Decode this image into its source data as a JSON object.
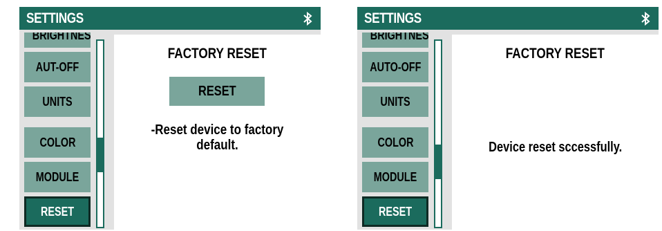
{
  "colors": {
    "accent": "#1b6b5d",
    "menu_item": "#7aa59b",
    "background": "#e2e2e2",
    "panel": "#ffffff"
  },
  "screens": [
    {
      "title": "SETTINGS",
      "status_icon": "bluetooth-icon",
      "menu": [
        {
          "label": "BRIGHTNESS",
          "selected": false
        },
        {
          "label": "AUT-OFF",
          "selected": false
        },
        {
          "label": "UNITS",
          "selected": false
        },
        {
          "label": "COLOR",
          "selected": false
        },
        {
          "label": "MODULE",
          "selected": false
        },
        {
          "label": "RESET",
          "selected": true
        }
      ],
      "panel": {
        "title": "FACTORY RESET",
        "button_label": "RESET",
        "description": "-Reset device to factory default."
      }
    },
    {
      "title": "SETTINGS",
      "status_icon": "bluetooth-icon",
      "menu": [
        {
          "label": "BRIGHTNESS",
          "selected": false
        },
        {
          "label": "AUTO-OFF",
          "selected": false
        },
        {
          "label": "UNITS",
          "selected": false
        },
        {
          "label": "COLOR",
          "selected": false
        },
        {
          "label": "MODULE",
          "selected": false
        },
        {
          "label": "RESET",
          "selected": true
        }
      ],
      "panel": {
        "title": "FACTORY RESET",
        "message": "Device reset sccessfully."
      }
    }
  ]
}
